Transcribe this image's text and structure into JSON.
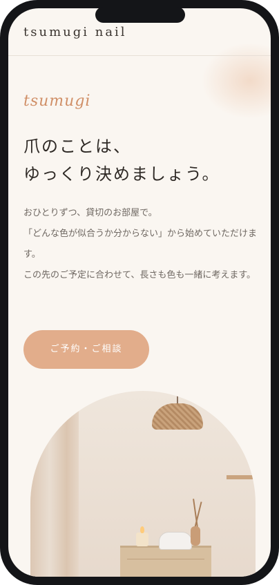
{
  "header": {
    "brand": "tsumugi nail"
  },
  "hero": {
    "script_label": "tsumugi",
    "title_lines": [
      "爪のことは、",
      "ゆっくり決めましょう。"
    ],
    "body_lines": [
      "おひとりずつ、貸切のお部屋で。",
      "「どんな色が似合うか分からない」から始めていただけます。",
      "この先のご予定に合わせて、長さも色も一緒に考えます。"
    ],
    "cta_label": "ご予約・ご相談"
  },
  "colors": {
    "accent": "#e2ad8b",
    "script": "#d08f67",
    "background": "#faf6f1",
    "text": "#2f2a26"
  }
}
